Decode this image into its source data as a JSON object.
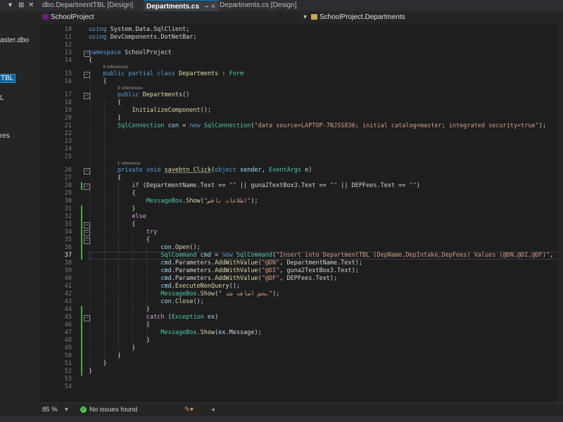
{
  "left_panel": {
    "controls": [
      "▾",
      "⊞",
      "✕"
    ],
    "items": [
      {
        "label": "aster.dbo",
        "selected": false
      },
      {
        "label": "TBL",
        "selected": true
      },
      {
        "label": "L",
        "selected": false
      },
      {
        "label": "res",
        "selected": false
      }
    ]
  },
  "tabs": [
    {
      "label": "dbo.DepartmentTBL [Design]",
      "active": false,
      "icons": ""
    },
    {
      "label": "Departments.cs",
      "active": true,
      "icons": "⊸ ✕"
    },
    {
      "label": "Departments.cs [Design]",
      "active": false,
      "icons": ""
    }
  ],
  "navbar": {
    "project": "SchoolProject",
    "class_path": "SchoolProject.Departments"
  },
  "editor": {
    "lines": [
      {
        "n": "10",
        "code": "using System.Data.SqlClient;"
      },
      {
        "n": "11",
        "code": "using DevComponents.DotNetBar;"
      },
      {
        "n": "12",
        "code": ""
      },
      {
        "n": "13",
        "code": "namespace SchoolProject"
      },
      {
        "n": "14",
        "code": "{"
      },
      {
        "n": "15",
        "code": "    public partial class Departments : Form",
        "lens": "8 references"
      },
      {
        "n": "16",
        "code": "    {"
      },
      {
        "n": "17",
        "code": "        public Departments()",
        "lens": "3 references"
      },
      {
        "n": "18",
        "code": "        {"
      },
      {
        "n": "19",
        "code": "            InitializeComponent();"
      },
      {
        "n": "20",
        "code": "        }"
      },
      {
        "n": "21",
        "code": "        SqlConnection con = new SqlConnection(\"data source=LAPTOP-7NJSS836; initial catalog=master; integrated security=true\");"
      },
      {
        "n": "22",
        "code": ""
      },
      {
        "n": "23",
        "code": ""
      },
      {
        "n": "24",
        "code": ""
      },
      {
        "n": "25",
        "code": ""
      },
      {
        "n": "26",
        "code": "        private void savebtn_Click(object sender, EventArgs e)",
        "lens": "1 reference"
      },
      {
        "n": "27",
        "code": "        {"
      },
      {
        "n": "28",
        "code": "            if (DepartmentName.Text == \"\" || guna2TextBox3.Text == \"\" || DEPFees.Text == \"\")"
      },
      {
        "n": "29",
        "code": "            {"
      },
      {
        "n": "30",
        "code": "                MessageBox.Show(\"اطلاعات ناقص\");"
      },
      {
        "n": "31",
        "code": "            }"
      },
      {
        "n": "32",
        "code": "            else"
      },
      {
        "n": "33",
        "code": "            {"
      },
      {
        "n": "34",
        "code": "                try"
      },
      {
        "n": "35",
        "code": "                {"
      },
      {
        "n": "36",
        "code": "                    con.Open();"
      },
      {
        "n": "37",
        "code": "                    SqlCommand cmd = new SqlCommand(\"Insert into DepartmentTBL (DepName,DepIntake,DepFees) Values (@DN,@DI,@DF)\", con);"
      },
      {
        "n": "38",
        "code": "                    cmd.Parameters.AddWithValue(\"@DN\", DepartmentName.Text);"
      },
      {
        "n": "39",
        "code": "                    cmd.Parameters.AddWithValue(\"@DI\", guna2TextBox3.Text);"
      },
      {
        "n": "40",
        "code": "                    cmd.Parameters.AddWithValue(\"@DF\", DEPFees.Text);"
      },
      {
        "n": "41",
        "code": "                    cmd.ExecuteNonQuery();"
      },
      {
        "n": "42",
        "code": "                    MessageBox.Show(\" بخش اضافه شد\");"
      },
      {
        "n": "43",
        "code": "                    con.Close();"
      },
      {
        "n": "44",
        "code": "                }"
      },
      {
        "n": "45",
        "code": "                catch (Exception ex)"
      },
      {
        "n": "46",
        "code": "                {"
      },
      {
        "n": "47",
        "code": "                    MessageBox.Show(ex.Message);"
      },
      {
        "n": "48",
        "code": "                }"
      },
      {
        "n": "49",
        "code": "            }"
      },
      {
        "n": "50",
        "code": "        }"
      },
      {
        "n": "51",
        "code": "    }"
      },
      {
        "n": "52",
        "code": "}"
      },
      {
        "n": "53",
        "code": ""
      },
      {
        "n": "54",
        "code": ""
      }
    ],
    "current_line": "37"
  },
  "status": {
    "zoom": "85 %",
    "issues": "No issues found"
  },
  "colors": {
    "keyword": "#569cd6",
    "type": "#4ec9b0",
    "string": "#d69d85",
    "method": "#dcdcaa",
    "variable": "#9cdcfe",
    "control": "#d8a0df",
    "change_bar": "#4ea44e"
  },
  "icons": [
    "pin-icon",
    "close-icon",
    "class-icon",
    "check-circle-icon",
    "brush-icon",
    "chevron-down-icon"
  ]
}
